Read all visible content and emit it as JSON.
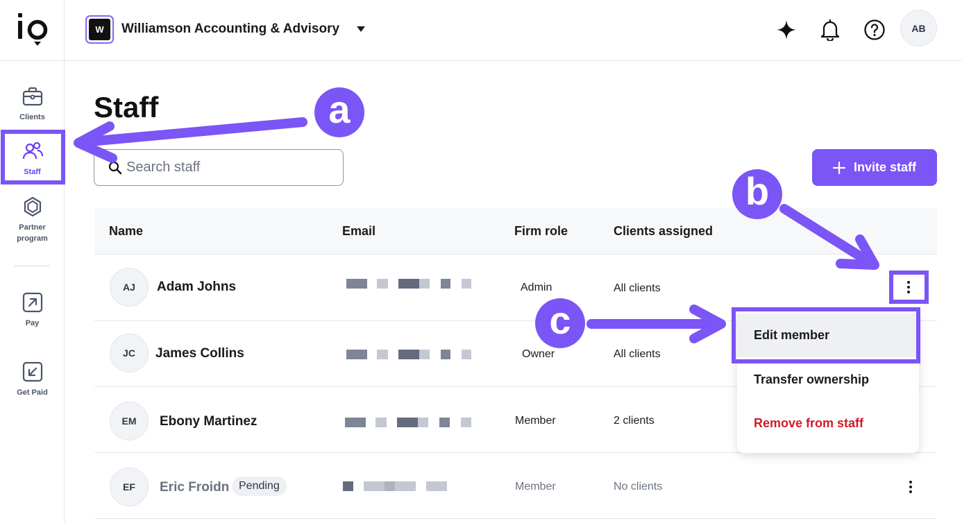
{
  "sidebar": {
    "logo_text": "io",
    "items": [
      {
        "label": "Clients",
        "icon": "briefcase-icon"
      },
      {
        "label": "Staff",
        "icon": "users-icon"
      },
      {
        "label": "Partner program",
        "icon": "gem-icon"
      },
      {
        "label": "Pay",
        "icon": "arrow-up-right-icon"
      },
      {
        "label": "Get Paid",
        "icon": "arrow-down-left-icon"
      }
    ]
  },
  "topbar": {
    "firm_initial": "W",
    "firm_name": "Williamson Accounting & Advisory",
    "user_initials": "AB"
  },
  "page": {
    "title": "Staff",
    "search_placeholder": "Search staff",
    "invite_label": "Invite staff"
  },
  "table": {
    "headers": [
      "Name",
      "Email",
      "Firm role",
      "Clients assigned"
    ],
    "rows": [
      {
        "initials": "AJ",
        "name": "Adam Johns",
        "badge": "",
        "role": "Admin",
        "clients": "All clients"
      },
      {
        "initials": "JC",
        "name": "James Collins",
        "badge": "",
        "role": "Owner",
        "clients": "All clients"
      },
      {
        "initials": "EM",
        "name": "Ebony Martinez",
        "badge": "",
        "role": "Member",
        "clients": "2 clients"
      },
      {
        "initials": "EF",
        "name": "Eric Froidn",
        "badge": "Pending",
        "role": "Member",
        "clients": "No clients"
      }
    ]
  },
  "menu": {
    "items": [
      "Edit member",
      "Transfer ownership",
      "Remove from staff"
    ]
  },
  "annotations": {
    "a": "a",
    "b": "b",
    "c": "c"
  },
  "colors": {
    "accent": "#7b55f5",
    "danger": "#d11a2a",
    "redacted_dark": "#6b7280",
    "redacted_light": "#c4c8d0"
  }
}
